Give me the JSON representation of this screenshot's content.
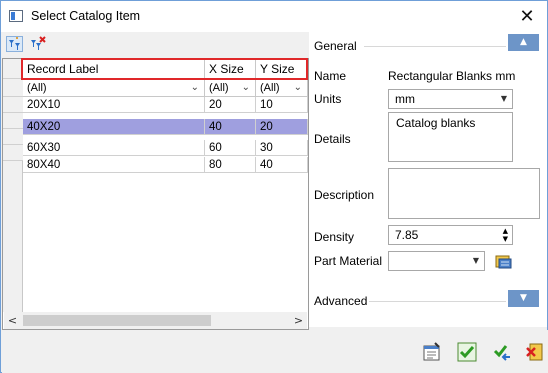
{
  "window": {
    "title": "Select Catalog Item",
    "close_glyph": "✕"
  },
  "toolbar": {
    "icons": [
      "filter-icon",
      "clear-filter-icon"
    ]
  },
  "grid": {
    "columns": [
      "Record Label",
      "X Size",
      "Y Size"
    ],
    "filters": [
      "(All)",
      "(All)",
      "(All)"
    ],
    "rows": [
      [
        "20X10",
        "20",
        "10"
      ],
      [
        "40X20",
        "40",
        "20"
      ],
      [
        "60X30",
        "60",
        "30"
      ],
      [
        "80X40",
        "80",
        "40"
      ]
    ],
    "selected_row": 1
  },
  "general": {
    "title": "General",
    "name_label": "Name",
    "name_value": "Rectangular Blanks mm",
    "units_label": "Units",
    "units_value": "mm",
    "details_label": "Details",
    "details_value": "Catalog blanks",
    "description_label": "Description",
    "description_value": "",
    "density_label": "Density",
    "density_value": "7.85",
    "material_label": "Part Material",
    "material_value": ""
  },
  "advanced": {
    "title": "Advanced"
  },
  "colors": {
    "selection": "#9f9fdf",
    "highlight_border": "#e0282a",
    "collapse_button": "#6d95c8"
  }
}
